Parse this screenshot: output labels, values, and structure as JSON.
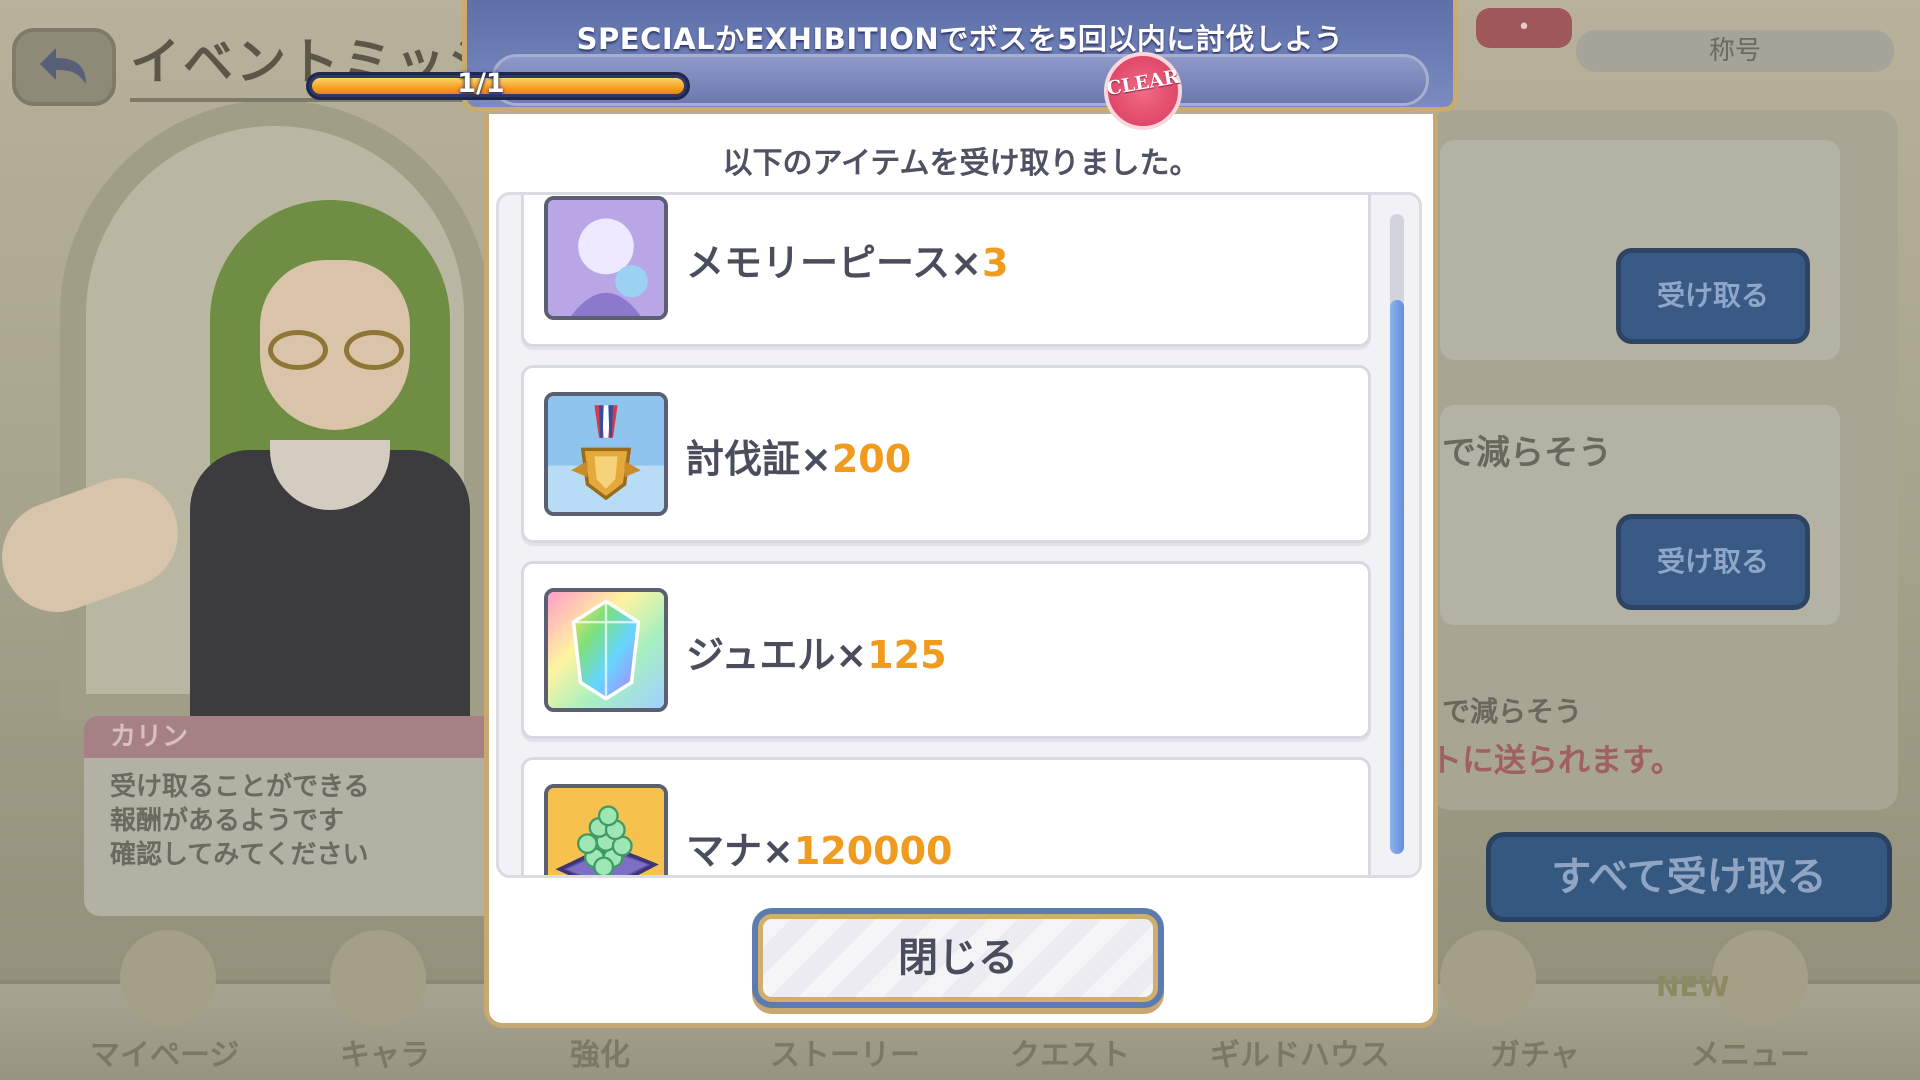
{
  "background": {
    "screen_title": "イベントミッシ",
    "tab_badge": "•",
    "tab_label": "称号",
    "receive_button": "受け取る",
    "mission_partial_1": "で減らそう",
    "mission_partial_2": "で減らそう",
    "notice": "トに送られます。",
    "receive_all_button": "すべて受け取る",
    "speaker": "カリン",
    "speech_lines": [
      "受け取ることができる",
      "報酬があるようです",
      "確認してみてください"
    ],
    "nav": [
      "マイページ",
      "キャラ",
      "強化",
      "ストーリー",
      "クエスト",
      "ギルドハウス",
      "ガチャ",
      "メニュー"
    ],
    "nav_new": "NEW"
  },
  "dialog": {
    "mission_title": "SPECIALかEXHIBITIONでボスを5回以内に討伐しよう",
    "progress_text": "1/1",
    "progress_fraction": 1.0,
    "clear_badge": "CLEAR",
    "message": "以下のアイテムを受け取りました。",
    "items": [
      {
        "name": "メモリーピース×",
        "count": "3",
        "icon": "memory-piece-icon"
      },
      {
        "name": "討伐証×",
        "count": "200",
        "icon": "medal-icon"
      },
      {
        "name": "ジュエル×",
        "count": "125",
        "icon": "jewel-icon"
      },
      {
        "name": "マナ×",
        "count": "120000",
        "icon": "mana-icon"
      }
    ],
    "close_button": "閉じる"
  },
  "colors": {
    "accent_gold": "#c7a872",
    "count_orange": "#f09a1e",
    "header_blue": "#6f80b8",
    "clear_pink": "#e0486a"
  }
}
